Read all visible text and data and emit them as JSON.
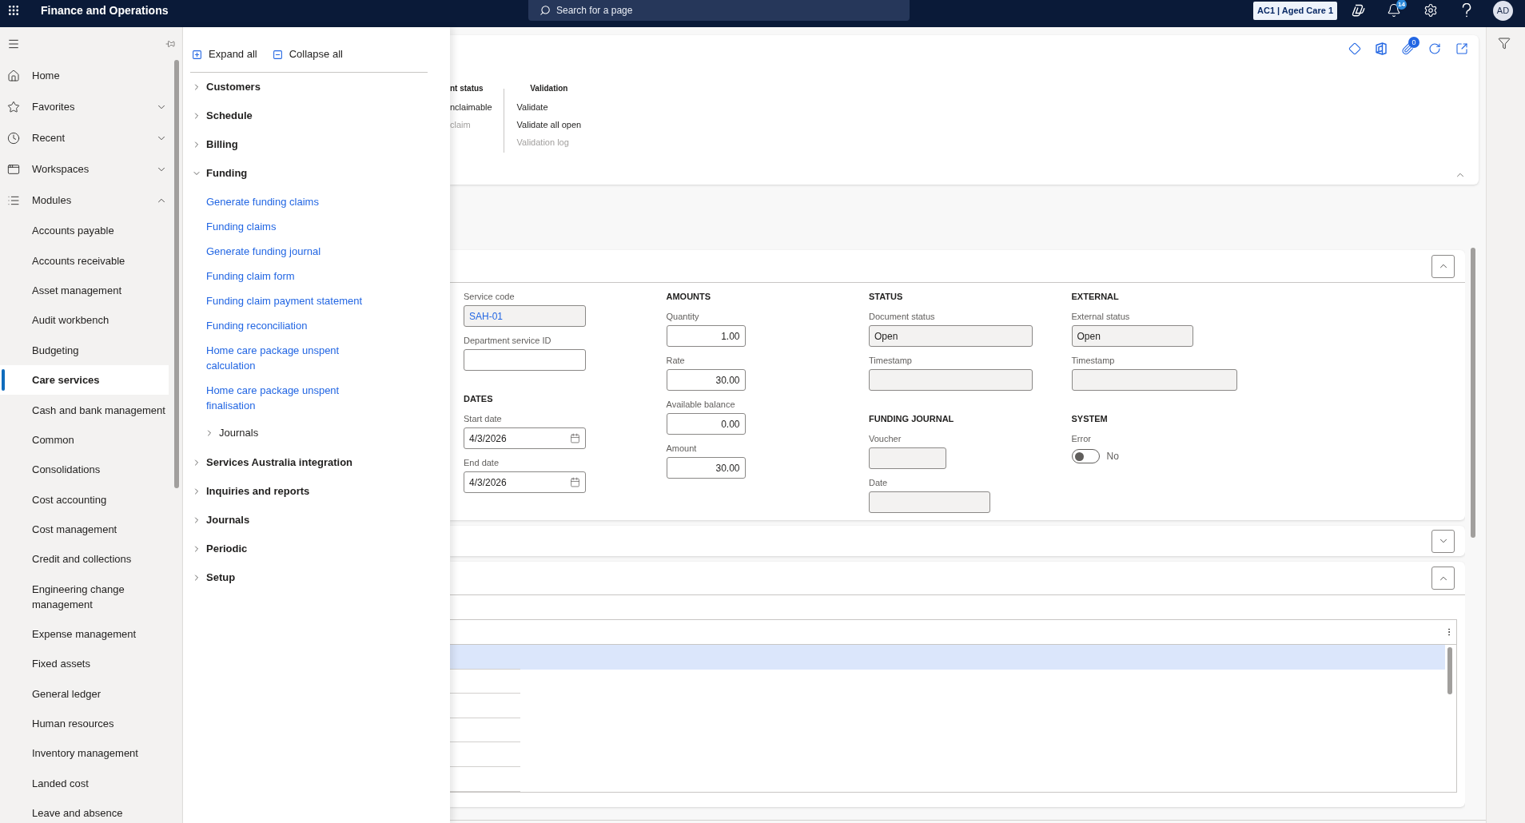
{
  "app_bar": {
    "title": "Finance and Operations",
    "search": {
      "placeholder": "Search for a page"
    },
    "company": "AC1 | Aged Care 1",
    "notification_count": "14",
    "user_initials": "AD"
  },
  "nav": {
    "items": [
      {
        "label": "Home",
        "kind": "link"
      },
      {
        "label": "Favorites",
        "kind": "group",
        "expanded": false
      },
      {
        "label": "Recent",
        "kind": "group",
        "expanded": false
      },
      {
        "label": "Workspaces",
        "kind": "group",
        "expanded": false
      },
      {
        "label": "Modules",
        "kind": "group",
        "expanded": true,
        "children": [
          {
            "label": "Accounts payable",
            "selected": false
          },
          {
            "label": "Accounts receivable",
            "selected": false
          },
          {
            "label": "Asset management",
            "selected": false
          },
          {
            "label": "Audit workbench",
            "selected": false
          },
          {
            "label": "Budgeting",
            "selected": false
          },
          {
            "label": "Care services",
            "selected": true
          },
          {
            "label": "Cash and bank management",
            "selected": false
          },
          {
            "label": "Common",
            "selected": false
          },
          {
            "label": "Consolidations",
            "selected": false
          },
          {
            "label": "Cost accounting",
            "selected": false
          },
          {
            "label": "Cost management",
            "selected": false
          },
          {
            "label": "Credit and collections",
            "selected": false
          },
          {
            "label": "Engineering change management",
            "selected": false
          },
          {
            "label": "Expense management",
            "selected": false
          },
          {
            "label": "Fixed assets",
            "selected": false
          },
          {
            "label": "General ledger",
            "selected": false
          },
          {
            "label": "Human resources",
            "selected": false
          },
          {
            "label": "Inventory management",
            "selected": false
          },
          {
            "label": "Landed cost",
            "selected": false
          },
          {
            "label": "Leave and absence",
            "selected": false
          }
        ]
      }
    ]
  },
  "module_menu": {
    "toolbar": [
      {
        "label": "Expand all",
        "kind": "expand"
      },
      {
        "label": "Collapse all",
        "kind": "collapse"
      }
    ],
    "sections": [
      {
        "label": "Customers",
        "expanded": false
      },
      {
        "label": "Schedule",
        "expanded": false
      },
      {
        "label": "Billing",
        "expanded": false
      },
      {
        "label": "Funding",
        "expanded": true,
        "children": [
          {
            "kind": "link",
            "label": "Generate funding claims"
          },
          {
            "kind": "link",
            "label": "Funding claims"
          },
          {
            "kind": "link",
            "label": "Generate funding journal"
          },
          {
            "kind": "link",
            "label": "Funding claim form"
          },
          {
            "kind": "link",
            "label": "Funding claim payment statement"
          },
          {
            "kind": "link",
            "label": "Funding reconciliation"
          },
          {
            "kind": "link",
            "label": "Home care package unspent calculation"
          },
          {
            "kind": "link",
            "label": "Home care package unspent finalisation"
          },
          {
            "kind": "group",
            "label": "Journals",
            "expanded": false
          }
        ]
      },
      {
        "label": "Services Australia integration",
        "expanded": false
      },
      {
        "label": "Inquiries and reports",
        "expanded": false
      },
      {
        "label": "Journals",
        "expanded": false
      },
      {
        "label": "Periodic",
        "expanded": false
      },
      {
        "label": "Setup",
        "expanded": false
      }
    ]
  },
  "action_pane": {
    "expanded": true,
    "attachment_count": "0",
    "groups": [
      {
        "heading": "nt status",
        "items": [
          {
            "label": "nclaimable",
            "disabled": false
          },
          {
            "label": "claim",
            "disabled": true
          }
        ]
      },
      {
        "heading": "Validation",
        "items": [
          {
            "label": "Validate",
            "disabled": false
          },
          {
            "label": "Validate all open",
            "disabled": false
          },
          {
            "label": "Validation log",
            "disabled": true
          }
        ]
      }
    ]
  },
  "fasttabs": [
    {
      "kind": "fields",
      "expanded": true,
      "columns": [
        {
          "groups": [
            {
              "fields": [
                {
                  "label": "Service code",
                  "kind": "lookup",
                  "value": "SAH-01",
                  "readonly": true
                },
                {
                  "label": "Department service ID",
                  "kind": "text",
                  "readonly": false
                }
              ]
            },
            {
              "heading": "DATES",
              "fields": [
                {
                  "label": "Start date",
                  "kind": "date",
                  "value": "4/3/2026",
                  "readonly": false
                },
                {
                  "label": "End date",
                  "kind": "date",
                  "value": "4/3/2026",
                  "readonly": false
                }
              ]
            }
          ]
        },
        {
          "groups": [
            {
              "heading": "AMOUNTS",
              "fields": [
                {
                  "label": "Quantity",
                  "kind": "number",
                  "value": "1.00",
                  "readonly": false
                },
                {
                  "label": "Rate",
                  "kind": "number",
                  "value": "30.00",
                  "readonly": false
                },
                {
                  "label": "Available balance",
                  "kind": "number",
                  "value": "0.00",
                  "readonly": false
                },
                {
                  "label": "Amount",
                  "kind": "number",
                  "value": "30.00",
                  "readonly": false
                }
              ]
            }
          ]
        },
        {
          "groups": [
            {
              "heading": "STATUS",
              "fields": [
                {
                  "label": "Document status",
                  "kind": "text",
                  "value": "Open",
                  "readonly": true
                },
                {
                  "label": "Timestamp",
                  "kind": "text",
                  "readonly": true
                }
              ]
            },
            {
              "heading": "FUNDING JOURNAL",
              "fields": [
                {
                  "label": "Voucher",
                  "kind": "text",
                  "readonly": true
                },
                {
                  "label": "Date",
                  "kind": "text",
                  "readonly": true
                }
              ]
            }
          ]
        },
        {
          "groups": [
            {
              "heading": "EXTERNAL",
              "fields": [
                {
                  "label": "External status",
                  "kind": "text",
                  "value": "Open",
                  "readonly": true
                },
                {
                  "label": "Timestamp",
                  "kind": "text",
                  "readonly": true
                }
              ]
            },
            {
              "heading": "SYSTEM",
              "fields": [
                {
                  "label": "Error",
                  "kind": "toggle",
                  "on": false,
                  "value": "No"
                }
              ]
            }
          ]
        }
      ]
    },
    {
      "kind": "fields",
      "expanded": false
    },
    {
      "kind": "grid",
      "expanded": true,
      "rows": [
        {
          "selected": true
        },
        {
          "selected": false
        },
        {
          "selected": false
        },
        {
          "selected": false
        },
        {
          "selected": false
        },
        {
          "selected": false
        }
      ]
    }
  ]
}
